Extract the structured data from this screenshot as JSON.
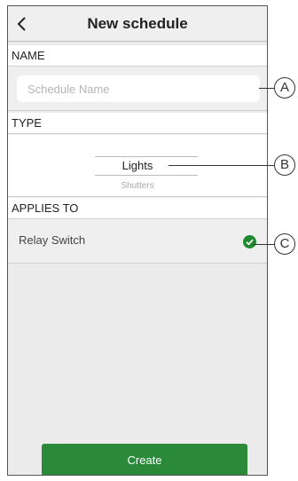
{
  "header": {
    "title": "New schedule"
  },
  "name_section": {
    "label": "NAME",
    "placeholder": "Schedule Name"
  },
  "type_section": {
    "label": "TYPE",
    "selected": "Lights",
    "next_option": "Shutters"
  },
  "applies_section": {
    "label": "APPLIES TO",
    "item": "Relay Switch",
    "item_selected": true
  },
  "actions": {
    "create_label": "Create"
  },
  "callouts": {
    "a": "A",
    "b": "B",
    "c": "C"
  },
  "colors": {
    "accent": "#2a8a3a",
    "check": "#1e8a2e",
    "background": "#ebebeb"
  }
}
